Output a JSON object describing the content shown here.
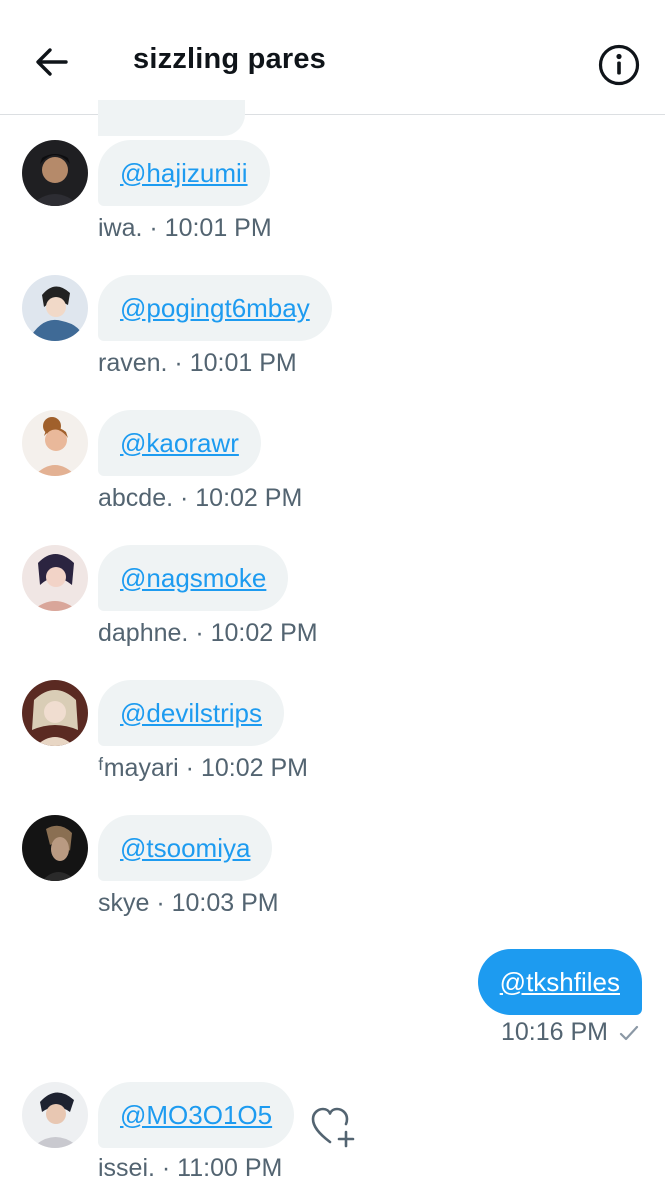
{
  "header": {
    "title": "sizzling pares",
    "back_icon": "arrow-left-icon",
    "info_icon": "info-circle-icon"
  },
  "messages": [
    {
      "handle": "@hajizumii",
      "sender": "iwa.",
      "time": "10:01 PM",
      "meta": "iwa. · 10:01 PM"
    },
    {
      "handle": "@pogingt6mbay",
      "sender": "raven.",
      "time": "10:01 PM",
      "meta": "raven. · 10:01 PM"
    },
    {
      "handle": "@kaorawr",
      "sender": "abcde.",
      "time": "10:02 PM",
      "meta": "abcde. · 10:02 PM"
    },
    {
      "handle": "@nagsmoke",
      "sender": "daphne.",
      "time": "10:02 PM",
      "meta": "daphne. · 10:02 PM"
    },
    {
      "handle": "@devilstrips",
      "sender": "ᶠmayari",
      "time": "10:02 PM",
      "meta": "ᶠmayari · 10:02 PM"
    },
    {
      "handle": "@tsoomiya",
      "sender": "skye",
      "time": "10:03 PM",
      "meta": "skye · 10:03 PM"
    }
  ],
  "sent": {
    "handle": "@tkshfiles",
    "time": "10:16 PM",
    "status_icon": "checkmark-icon"
  },
  "last": {
    "handle": "@MO3O1O5",
    "meta": "issei. · 11:00 PM",
    "reaction_icon": "heart-add-icon"
  },
  "colors": {
    "accent": "#1d9bf0",
    "bubble_bg": "#eff3f4",
    "meta_text": "#536471"
  }
}
